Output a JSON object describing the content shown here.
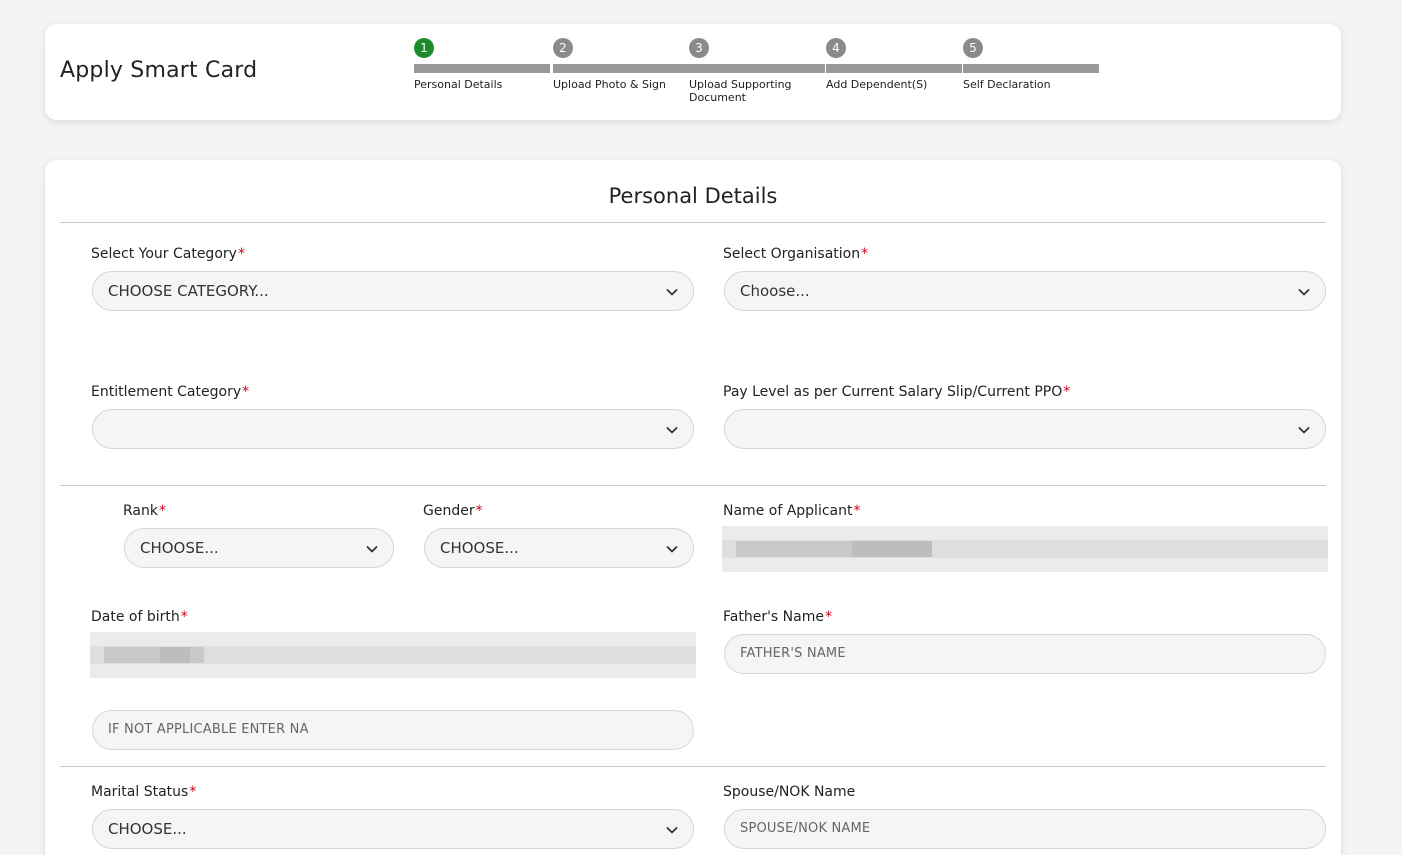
{
  "header": {
    "title": "Apply Smart Card",
    "steps": [
      {
        "num": "1",
        "label": "Personal Details",
        "state": "active"
      },
      {
        "num": "2",
        "label": "Upload Photo & Sign",
        "state": "pending"
      },
      {
        "num": "3",
        "label": "Upload Supporting Document",
        "state": "pending"
      },
      {
        "num": "4",
        "label": "Add Dependent(S)",
        "state": "pending"
      },
      {
        "num": "5",
        "label": "Self Declaration",
        "state": "pending"
      }
    ]
  },
  "form": {
    "section_title": "Personal Details",
    "required_mark": "*",
    "category": {
      "label": "Select Your Category",
      "value": "CHOOSE CATEGORY..."
    },
    "organisation": {
      "label": "Select Organisation",
      "value": "Choose..."
    },
    "entitlement": {
      "label": "Entitlement Category",
      "value": ""
    },
    "pay_level": {
      "label": "Pay Level as per Current Salary Slip/Current PPO",
      "value": ""
    },
    "rank": {
      "label": "Rank",
      "value": "CHOOSE..."
    },
    "gender": {
      "label": "Gender",
      "value": "CHOOSE..."
    },
    "applicant_name": {
      "label": "Name of Applicant"
    },
    "dob": {
      "label": "Date of birth"
    },
    "father_name": {
      "label": "Father's Name",
      "placeholder": "FATHER'S NAME"
    },
    "na_field": {
      "placeholder": "IF NOT APPLICABLE ENTER NA"
    },
    "marital_status": {
      "label": "Marital Status",
      "value": "CHOOSE..."
    },
    "spouse_name": {
      "label": "Spouse/NOK Name",
      "placeholder": "SPOUSE/NOK NAME"
    }
  },
  "colors": {
    "active_step": "#1e8a2a",
    "pending_step": "#8a8a8a",
    "required": "#d0021b"
  },
  "icons": {
    "dropdown": "chevron-down-icon"
  }
}
